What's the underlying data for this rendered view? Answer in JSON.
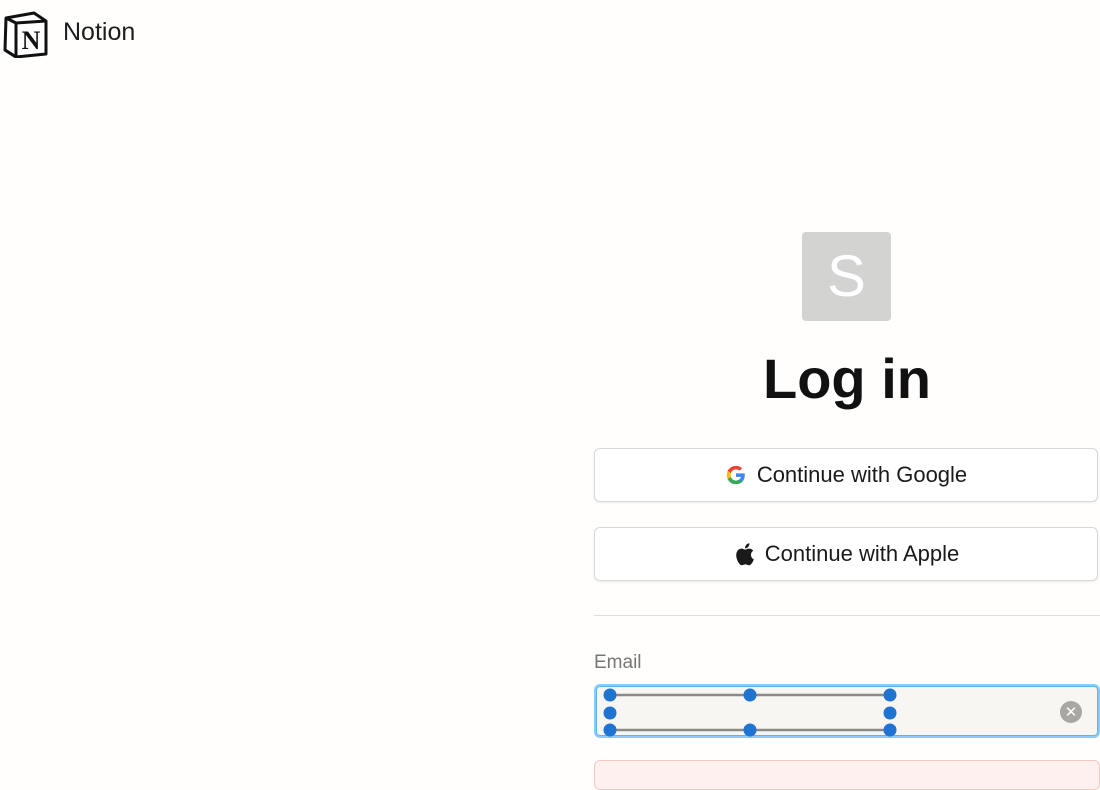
{
  "header": {
    "brand": "Notion",
    "logo_icon": "notion-logo-icon"
  },
  "avatar": {
    "letter": "S"
  },
  "page": {
    "title": "Log in"
  },
  "oauth": {
    "google_label": "Continue with Google",
    "google_icon": "google-icon",
    "apple_label": "Continue with Apple",
    "apple_icon": "apple-icon"
  },
  "email": {
    "label": "Email",
    "value": "",
    "clear_icon": "clear-icon"
  },
  "colors": {
    "background": "#fffefc",
    "avatar_bg": "#d3d3d2",
    "focus_ring": "#8ccbf3",
    "selection_handle": "#1f73d1",
    "error_bg": "#fdf0ee"
  }
}
